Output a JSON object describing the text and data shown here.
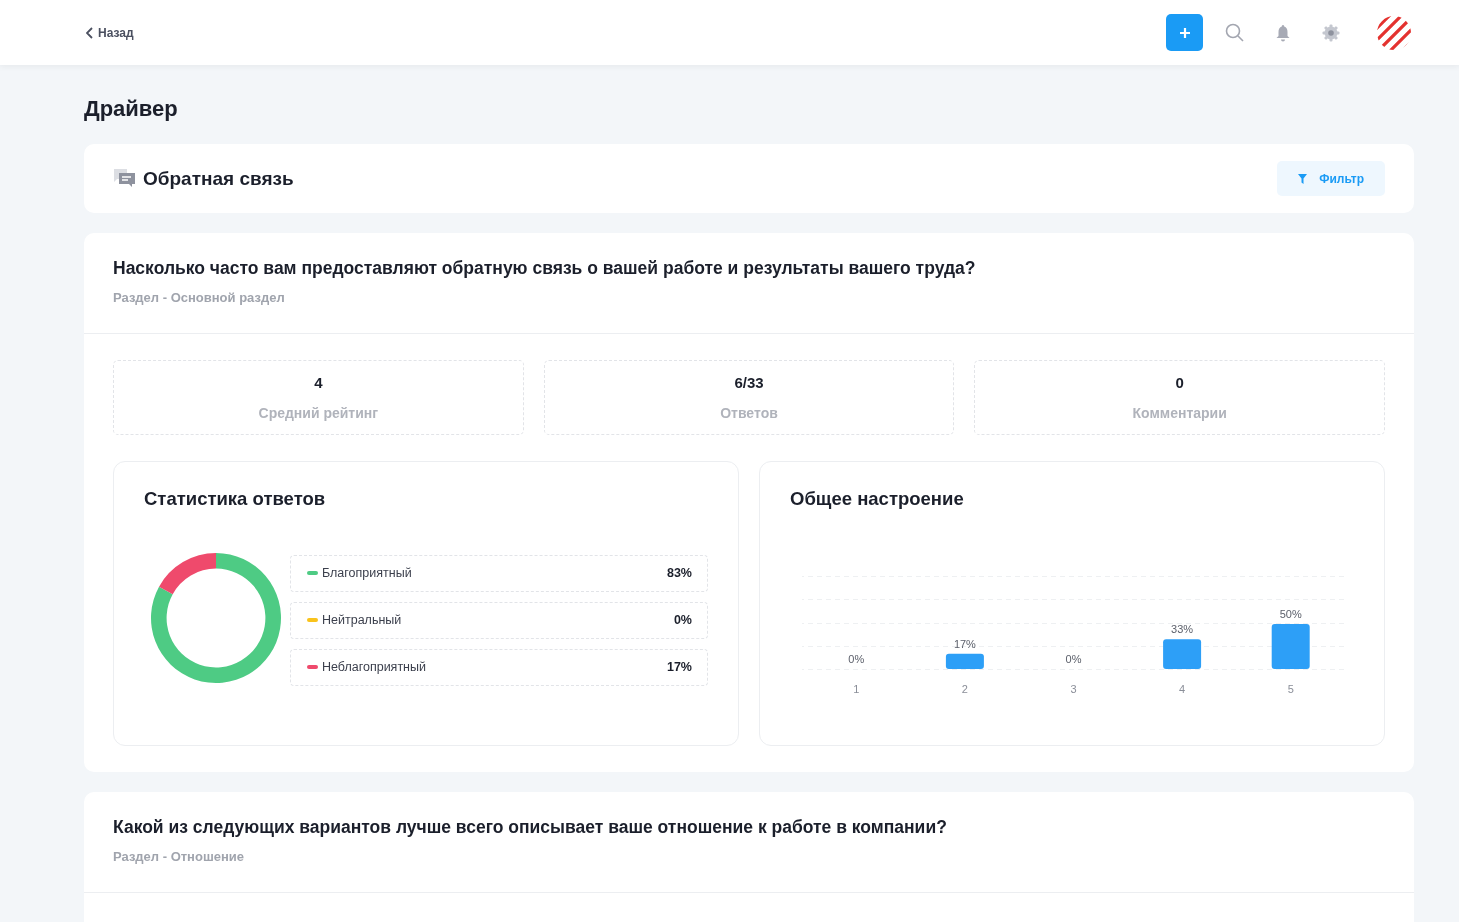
{
  "header": {
    "back_label": "Назад"
  },
  "page_title": "Драйвер",
  "section": {
    "title": "Обратная связь",
    "filter_label": "Фильтр"
  },
  "questions": [
    {
      "question": "Насколько часто вам предоставляют обратную связь о вашей работе и результаты вашего труда?",
      "section": "Раздел - Основной раздел",
      "stats": [
        {
          "value": "4",
          "label": "Средний рейтинг"
        },
        {
          "value": "6/33",
          "label": "Ответов"
        },
        {
          "value": "0",
          "label": "Комментарии"
        }
      ],
      "response_stats": {
        "title": "Статистика ответов",
        "legend": [
          {
            "label": "Благоприятный",
            "value": "83%",
            "color": "#4ecb84"
          },
          {
            "label": "Нейтральный",
            "value": "0%",
            "color": "#f9c31c"
          },
          {
            "label": "Неблагоприятный",
            "value": "17%",
            "color": "#ef4a6c"
          }
        ],
        "chart_data": {
          "type": "donut",
          "values": [
            83,
            0,
            17
          ]
        }
      },
      "mood": {
        "title": "Общее настроение",
        "chart_data": {
          "type": "bar",
          "categories": [
            "1",
            "2",
            "3",
            "4",
            "5"
          ],
          "values": [
            0,
            17,
            0,
            33,
            50
          ],
          "data_labels": true,
          "value_labels": [
            "0%",
            "17%",
            "0%",
            "33%",
            "50%"
          ]
        }
      }
    },
    {
      "question": "Какой из следующих вариантов лучше всего описывает ваше отношение к работе в компании?",
      "section": "Раздел - Отношение"
    }
  ]
}
